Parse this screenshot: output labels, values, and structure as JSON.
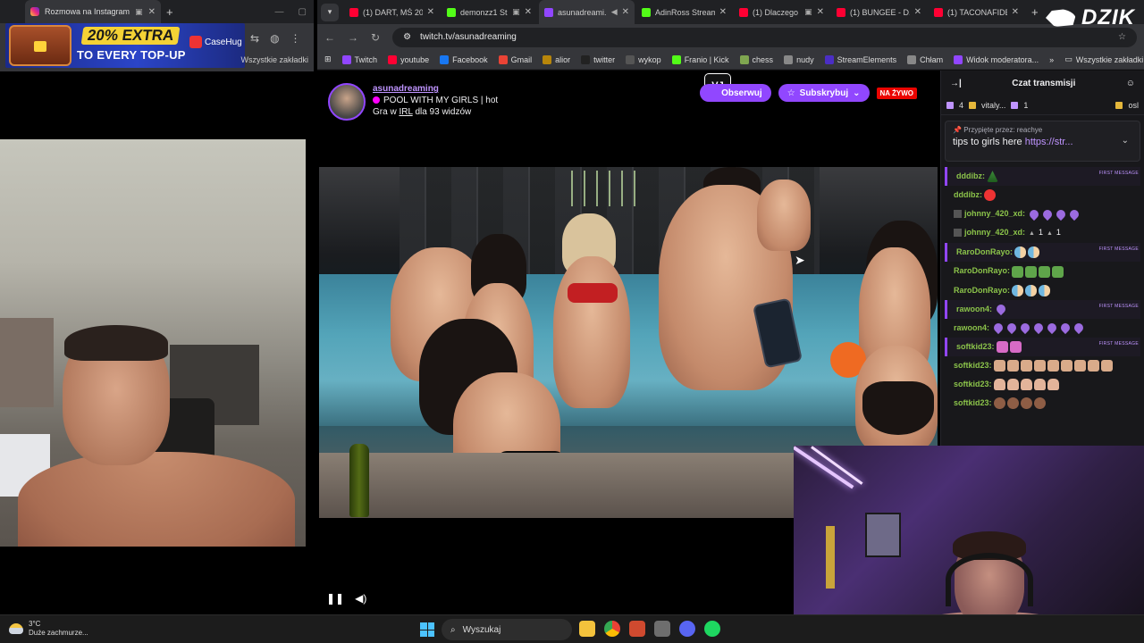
{
  "left_browser": {
    "tab_title": "Rozmowa na Instagramie",
    "ad": {
      "badge": "20% EXTRA",
      "text": "TO EVERY TOP-UP",
      "brand": "CaseHug"
    },
    "bookmarks_label": "Wszystkie zakładki"
  },
  "right_browser": {
    "tabs": [
      {
        "title": "(1) DART, MŚ 20...",
        "icon": "youtube",
        "active": false
      },
      {
        "title": "demonzz1 St...",
        "icon": "kick",
        "active": false
      },
      {
        "title": "asunadreami...",
        "icon": "twitch",
        "active": true
      },
      {
        "title": "AdinRoss Stream",
        "icon": "kick",
        "active": false
      },
      {
        "title": "(1) Dlaczego",
        "icon": "youtube",
        "active": false
      },
      {
        "title": "(1) BUNGEE - D...",
        "icon": "youtube",
        "active": false
      },
      {
        "title": "(1) TACONAFIDE",
        "icon": "youtube",
        "active": false
      }
    ],
    "url": "twitch.tv/asunadreaming",
    "bookmarks": [
      {
        "label": "Twitch",
        "color": "#9146ff"
      },
      {
        "label": "youtube",
        "color": "#ff0033"
      },
      {
        "label": "Facebook",
        "color": "#1877f2"
      },
      {
        "label": "Gmail",
        "color": "#ea4335"
      },
      {
        "label": "alior",
        "color": "#b8860b"
      },
      {
        "label": "twitter",
        "color": "#222222"
      },
      {
        "label": "wykop",
        "color": "#555555"
      },
      {
        "label": "Franio | Kick",
        "color": "#53fc18"
      },
      {
        "label": "chess",
        "color": "#7fa650"
      },
      {
        "label": "nudy",
        "color": "#888888"
      },
      {
        "label": "StreamElements",
        "color": "#4b2ec4"
      },
      {
        "label": "Chłam",
        "color": "#888888"
      },
      {
        "label": "Widok moderatora...",
        "color": "#9146ff"
      }
    ],
    "bookmarks_all": "Wszystkie zakładki"
  },
  "stream": {
    "streamer": "asunadreaming",
    "title": "POOL WITH MY GIRLS | hot",
    "category_prefix": "Gra w",
    "category": "IRL",
    "viewers": "dla 93 widzów",
    "follow_label": "Obserwuj",
    "subscribe_label": "Subskrybuj",
    "live_label": "NA ŻYWO"
  },
  "chat": {
    "title": "Czat transmisji",
    "gifts": [
      {
        "text": "4"
      },
      {
        "text": "vitaly..."
      },
      {
        "text": "1"
      },
      {
        "text": "osl"
      }
    ],
    "pinned_by": "Przypięte przez: reachye",
    "pinned_text": "tips to girls here ",
    "pinned_link": "https://str...",
    "first_tag": "FIRST MESSAGE",
    "messages": [
      {
        "user": "dddibz:",
        "first": true,
        "emotes": [
          "tree"
        ]
      },
      {
        "user": "dddibz:",
        "first": false,
        "emotes": [
          "santa"
        ]
      },
      {
        "user": "johnny_420_xd:",
        "first": false,
        "badge": true,
        "emotes": [
          "purple",
          "purple",
          "purple",
          "purple"
        ]
      },
      {
        "user": "johnny_420_xd:",
        "first": false,
        "badge": true,
        "votes": [
          "1",
          "1"
        ]
      },
      {
        "user": "RaroDonRayo:",
        "first": true,
        "emotes": [
          "pill",
          "pill"
        ]
      },
      {
        "user": "RaroDonRayo:",
        "first": false,
        "emotes": [
          "money",
          "money",
          "money",
          "money"
        ]
      },
      {
        "user": "RaroDonRayo:",
        "first": false,
        "emotes": [
          "pill",
          "pill",
          "pill"
        ]
      },
      {
        "user": "rawoon4:",
        "first": true,
        "emotes": [
          "purple"
        ]
      },
      {
        "user": "rawoon4:",
        "first": false,
        "emotes": [
          "purple",
          "purple",
          "purple",
          "purple",
          "purple",
          "purple",
          "purple"
        ]
      },
      {
        "user": "softkid23:",
        "first": true,
        "emotes": [
          "pink",
          "pink"
        ]
      },
      {
        "user": "softkid23:",
        "first": false,
        "emotes": [
          "face",
          "face",
          "face",
          "face",
          "face",
          "face",
          "face",
          "face",
          "face"
        ]
      },
      {
        "user": "softkid23:",
        "first": false,
        "emotes": [
          "hand",
          "hand",
          "hand",
          "hand",
          "hand"
        ]
      },
      {
        "user": "softkid23:",
        "first": false,
        "emotes": [
          "open",
          "open",
          "open",
          "open"
        ]
      }
    ]
  },
  "overlay_logo": "DZIK",
  "taskbar": {
    "temperature": "3°C",
    "weather": "Duże zachmurze...",
    "search_placeholder": "Wyszukaj"
  }
}
